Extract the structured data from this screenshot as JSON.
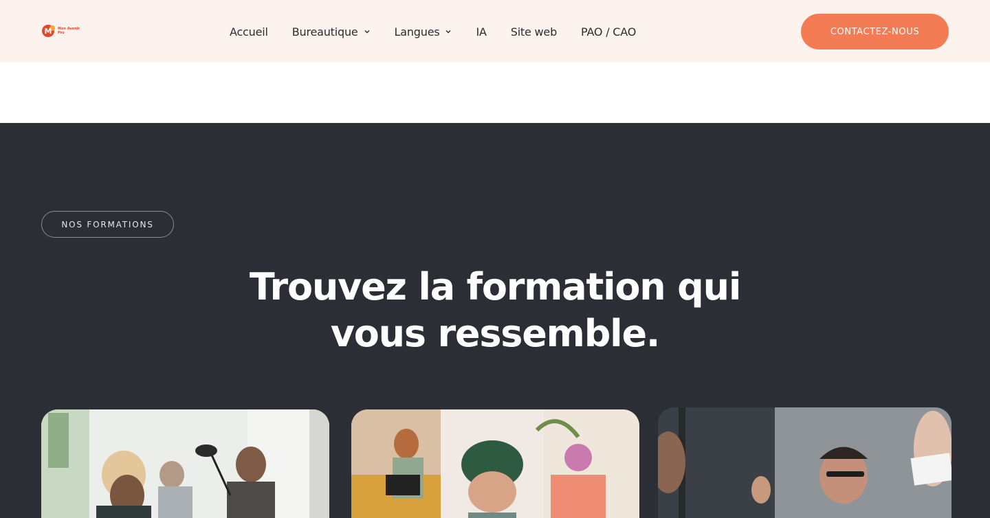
{
  "brand": {
    "logo_line1": "Mon Avenir",
    "logo_line2": "Pro",
    "logo_letter": "M"
  },
  "nav": {
    "items": [
      {
        "label": "Accueil",
        "has_dropdown": false
      },
      {
        "label": "Bureautique",
        "has_dropdown": true
      },
      {
        "label": "Langues",
        "has_dropdown": true
      },
      {
        "label": "IA",
        "has_dropdown": false
      },
      {
        "label": "Site web",
        "has_dropdown": false
      },
      {
        "label": "PAO / CAO",
        "has_dropdown": false
      }
    ]
  },
  "header": {
    "cta_label": "CONTACTEZ-NOUS"
  },
  "section": {
    "eyebrow": "NOS FORMATIONS",
    "headline_line1": "Trouvez la formation qui",
    "headline_line2": "vous ressemble."
  },
  "cards": [
    {
      "image": "office-team-photo"
    },
    {
      "image": "students-laptop-photo"
    },
    {
      "image": "business-meeting-photo"
    }
  ],
  "colors": {
    "header_bg": "#fdf3ee",
    "accent": "#f47c55",
    "dark_bg": "#2b2e34",
    "nav_text": "#2a2d33",
    "logo_red": "#e2462b"
  }
}
